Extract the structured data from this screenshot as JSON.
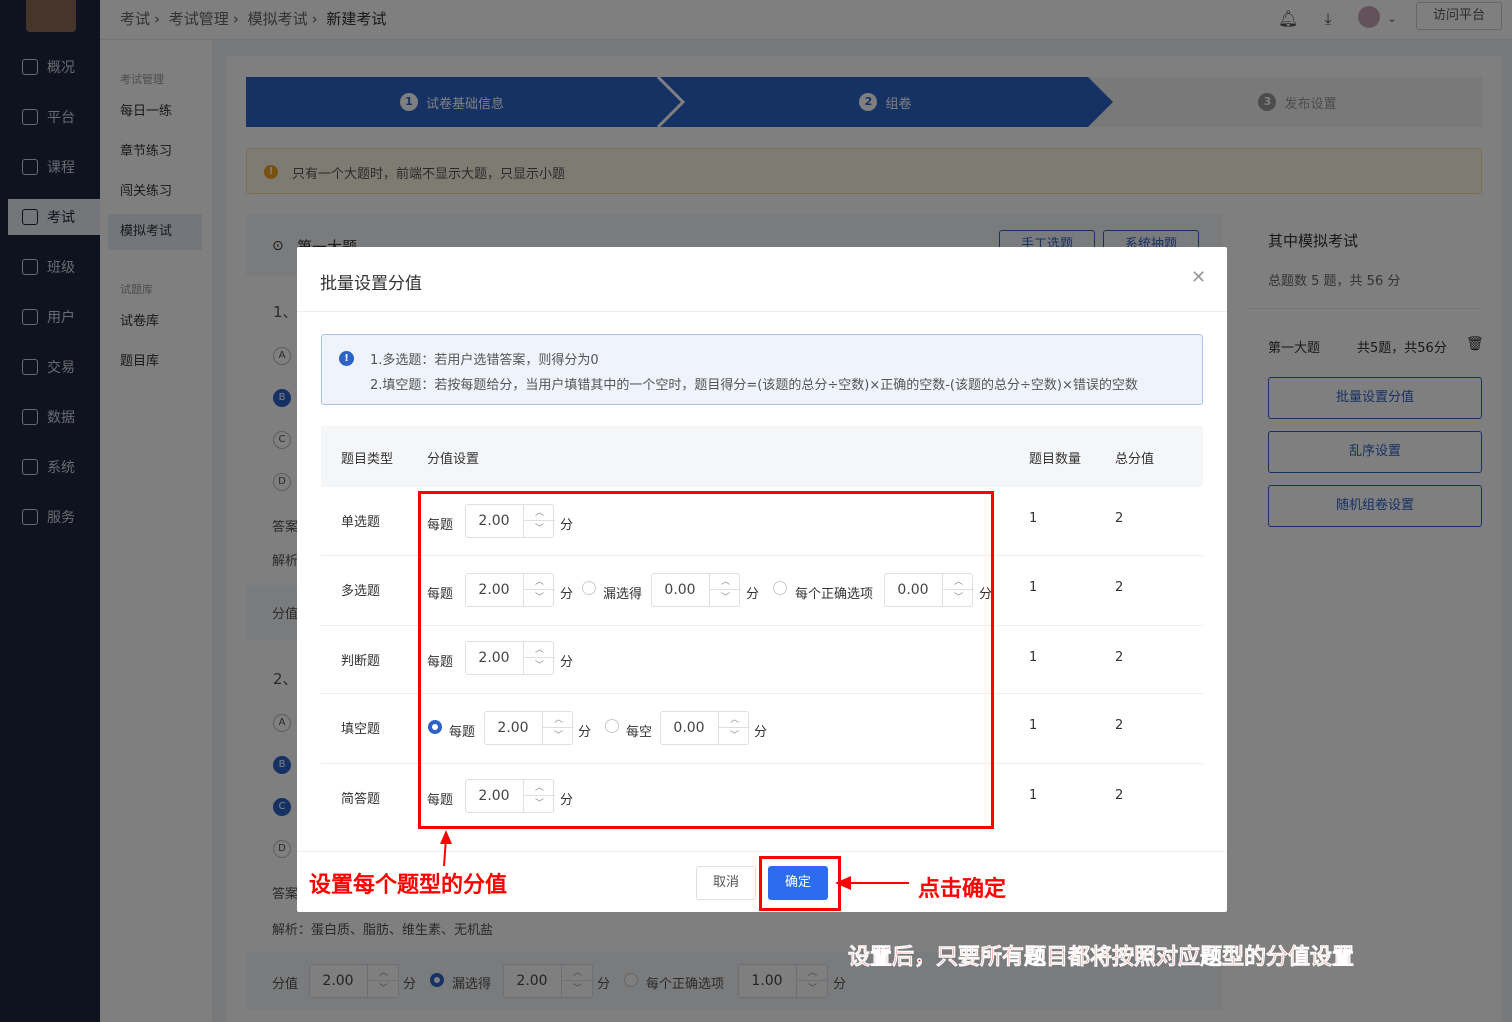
{
  "nav": {
    "items": [
      {
        "label": "概况",
        "icon": "pie-chart-icon"
      },
      {
        "label": "平台",
        "icon": "store-icon"
      },
      {
        "label": "课程",
        "icon": "book-icon"
      },
      {
        "label": "考试",
        "icon": "exam-icon"
      },
      {
        "label": "班级",
        "icon": "group-icon"
      },
      {
        "label": "用户",
        "icon": "user-icon"
      },
      {
        "label": "交易",
        "icon": "trade-icon"
      },
      {
        "label": "数据",
        "icon": "bar-chart-icon"
      },
      {
        "label": "系统",
        "icon": "gear-icon"
      },
      {
        "label": "服务",
        "icon": "service-icon"
      }
    ],
    "active": "考试"
  },
  "subnav": {
    "group1": "考试管理",
    "items1": [
      "每日一练",
      "章节练习",
      "闯关练习",
      "模拟考试"
    ],
    "group2": "试题库",
    "items2": [
      "试卷库",
      "题目库"
    ]
  },
  "header": {
    "crumbs": [
      "考试",
      "考试管理",
      "模拟考试",
      "新建考试"
    ],
    "visit": "访问平台"
  },
  "steps": [
    {
      "num": "1",
      "label": "试卷基础信息"
    },
    {
      "num": "2",
      "label": "组卷"
    },
    {
      "num": "3",
      "label": "发布设置"
    }
  ],
  "notice": "只有一个大题时，前端不显示大题，只显示小题",
  "background": {
    "section": "第一大题",
    "btn_manual": "手工选题",
    "btn_system": "系统抽题",
    "q1": "1、",
    "q2": "2、",
    "answer": "答案",
    "analysis": "解析",
    "score": "分值",
    "analysis_full": "解析：蛋白质、脂肪、维生素、无机盐",
    "bottom": {
      "score_label": "分值",
      "score": "2.00",
      "unit": "分",
      "miss_label": "漏选得",
      "miss": "2.00",
      "each_label": "每个正确选项",
      "each": "1.00"
    }
  },
  "right": {
    "title": "其中模拟考试",
    "summary": "总题数 5 题，共 56 分",
    "section": "第一大题",
    "section_sum": "共5题，共56分",
    "btn_batch": "批量设置分值",
    "btn_shuffle": "乱序设置",
    "btn_random": "随机组卷设置"
  },
  "dialog": {
    "title": "批量设置分值",
    "info1": "1.多选题：若用户选错答案，则得分为0",
    "info2": "2.填空题：若按每题给分，当用户填错其中的一个空时，题目得分=(该题的总分÷空数)×正确的空数-(该题的总分÷空数)×错误的空数",
    "headers": [
      "题目类型",
      "分值设置",
      "题目数量",
      "总分值"
    ],
    "unit": "分",
    "per_item": "每题",
    "miss_label": "漏选得",
    "each_correct_label": "每个正确选项",
    "per_blank": "每空",
    "rows": [
      {
        "type": "单选题",
        "score": "2.00",
        "count": "1",
        "total": "2"
      },
      {
        "type": "多选题",
        "score": "2.00",
        "miss": "0.00",
        "each": "0.00",
        "count": "1",
        "total": "2"
      },
      {
        "type": "判断题",
        "score": "2.00",
        "count": "1",
        "total": "2"
      },
      {
        "type": "填空题",
        "score": "2.00",
        "blank": "0.00",
        "count": "1",
        "total": "2"
      },
      {
        "type": "简答题",
        "score": "2.00",
        "count": "1",
        "total": "2"
      }
    ],
    "cancel": "取消",
    "ok": "确定"
  },
  "annotations": {
    "a1": "设置每个题型的分值",
    "a2": "点击确定",
    "a3": "设置后，只要所有题目都将按照对应题型的分值设置"
  },
  "colors": {
    "primary": "#2d62c9",
    "nav": "#1f2740",
    "annotation": "#ff0000"
  }
}
